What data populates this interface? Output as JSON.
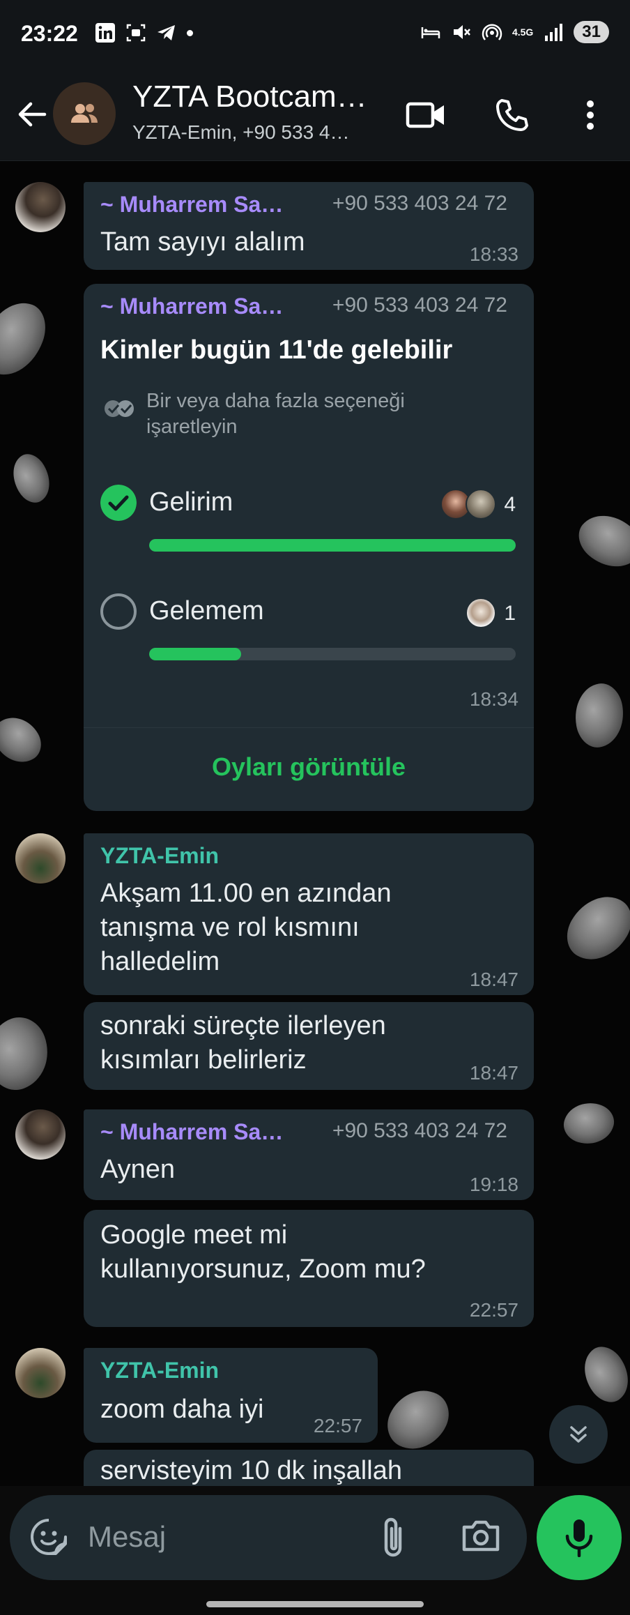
{
  "status_bar": {
    "time": "23:22",
    "left_icons": [
      "linkedin-icon",
      "screen-record-icon",
      "telegram-icon",
      "dot-icon"
    ],
    "right_icons": [
      "bed-icon",
      "mute-icon",
      "hotspot-icon",
      "network-4g-icon",
      "signal-icon"
    ],
    "network_label": "4.5G",
    "battery": "31"
  },
  "header": {
    "title": "YZTA Bootcam…",
    "subtitle": "YZTA-Emin, +90 533 4…",
    "icons": [
      "back-arrow-icon",
      "group-avatar-icon",
      "video-call-icon",
      "phone-call-icon",
      "more-options-icon"
    ]
  },
  "messages": [
    {
      "sender": "~ Muharrem Sa…",
      "phone": "+90 533 403 24 72",
      "text": "Tam sayıyı alalım",
      "time": "18:33"
    },
    {
      "sender": "~ Muharrem Sa…",
      "phone": "+90 533 403 24 72",
      "poll": {
        "question": "Kimler bugün 11'de gelebilir",
        "hint_line1": "Bir veya daha fazla seçeneği",
        "hint_line2": "işaretleyin",
        "options": [
          {
            "label": "Gelirim",
            "votes": "4",
            "fraction": 1.0,
            "selected": true
          },
          {
            "label": "Gelemem",
            "votes": "1",
            "fraction": 0.25,
            "selected": false
          }
        ],
        "time": "18:34",
        "view_votes": "Oyları görüntüle"
      }
    },
    {
      "sender": "YZTA-Emin",
      "text_lines": [
        "Akşam 11.00 en azından",
        "tanışma ve rol kısmını",
        "halledelim"
      ],
      "time": "18:47"
    },
    {
      "text_lines": [
        "sonraki süreçte ilerleyen",
        "kısımları belirleriz"
      ],
      "time": "18:47"
    },
    {
      "sender": "~ Muharrem Sa…",
      "phone": "+90 533 403 24 72",
      "text": "Aynen",
      "time": "19:18"
    },
    {
      "text_lines": [
        "Google meet mi",
        "kullanıyorsunuz, Zoom mu?"
      ],
      "time": "22:57"
    },
    {
      "sender": "YZTA-Emin",
      "text": "zoom daha iyi",
      "time": "22:57"
    },
    {
      "text": "servisteyim 10 dk inşallah"
    }
  ],
  "composer": {
    "placeholder": "Mesaj",
    "icons": [
      "emoji-sticker-icon",
      "attach-icon",
      "camera-icon",
      "microphone-icon",
      "scroll-down-icon"
    ]
  },
  "colors": {
    "accent_green": "#25c35d",
    "bubble": "#202c33",
    "sender_purple": "#a78bfa",
    "sender_teal": "#40c4aa"
  }
}
